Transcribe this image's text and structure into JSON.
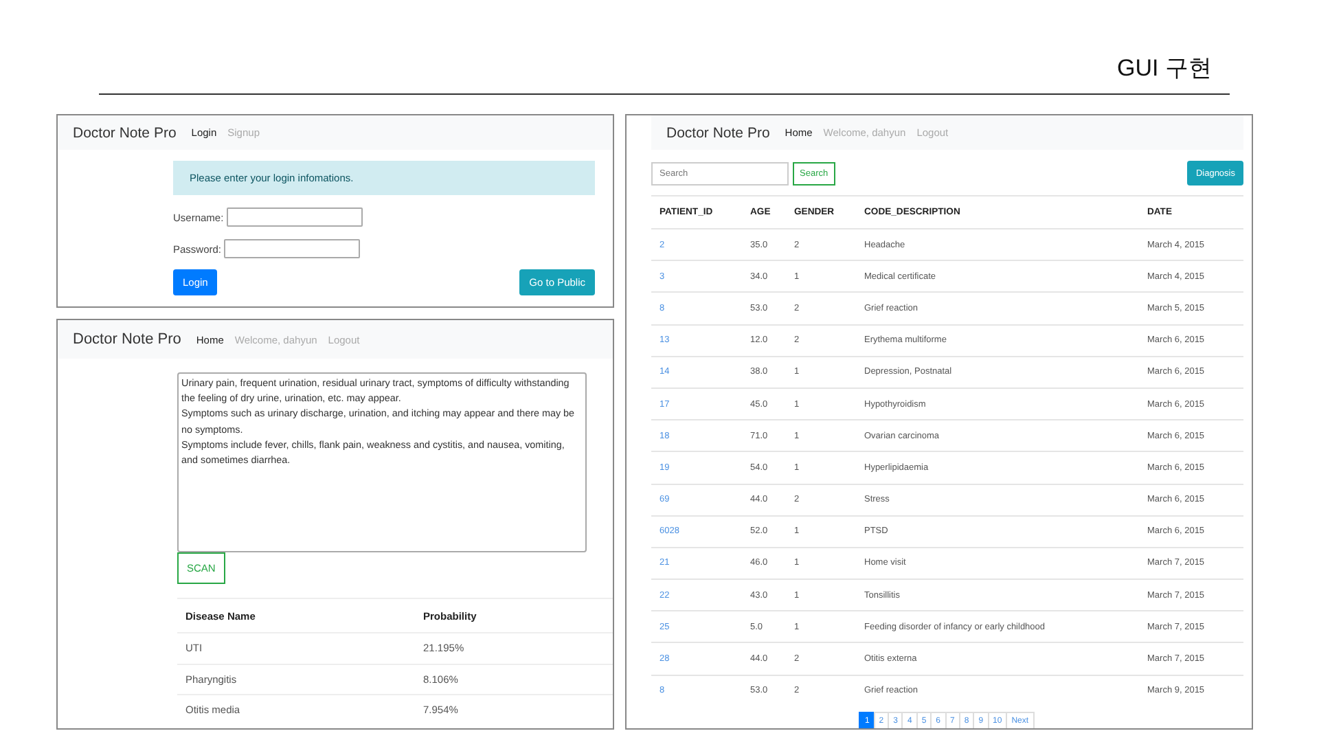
{
  "slide": {
    "title": "GUI 구현"
  },
  "login_screen": {
    "navbar": {
      "brand": "Doctor Note Pro",
      "links": [
        {
          "label": "Login",
          "selected": true
        },
        {
          "label": "Signup",
          "selected": false
        }
      ]
    },
    "alert": "Please enter your login infomations.",
    "fields": [
      {
        "label": "Username:"
      },
      {
        "label": "Password:"
      }
    ],
    "buttons": [
      {
        "label": "Login",
        "kind": "primary"
      },
      {
        "label": "Go to Public",
        "kind": "info"
      }
    ]
  },
  "scan_screen": {
    "navbar": {
      "brand": "Doctor Note Pro",
      "links": [
        {
          "label": "Home",
          "selected": true
        },
        {
          "label": "Welcome, dahyun",
          "selected": false
        },
        {
          "label": "Logout",
          "selected": false
        }
      ]
    },
    "symptoms_text": "Urinary pain, frequent urination, residual urinary tract, symptoms of difficulty withstanding the feeling of dry urine, urination, etc. may appear.\nSymptoms such as urinary discharge, urination, and itching may appear and there may be no symptoms.\nSymptoms include fever, chills, flank pain, weakness and cystitis, and nausea, vomiting, and sometimes diarrhea.",
    "scan_button": "SCAN",
    "results": {
      "columns": [
        "Disease Name",
        "Probability"
      ],
      "rows": [
        [
          "UTI",
          "21.195%"
        ],
        [
          "Pharyngitis",
          "8.106%"
        ],
        [
          "Otitis media",
          "7.954%"
        ]
      ]
    }
  },
  "patients_screen": {
    "navbar": {
      "brand": "Doctor Note Pro",
      "links": [
        {
          "label": "Home",
          "selected": true
        },
        {
          "label": "Welcome, dahyun",
          "selected": false
        },
        {
          "label": "Logout",
          "selected": false
        }
      ]
    },
    "search": {
      "placeholder": "Search"
    },
    "search_button": "Search",
    "diagnosis_button": "Diagnosis",
    "table": {
      "columns": [
        "PATIENT_ID",
        "AGE",
        "GENDER",
        "CODE_DESCRIPTION",
        "DATE"
      ],
      "rows": [
        [
          "2",
          "35.0",
          "2",
          "Headache",
          "March 4, 2015"
        ],
        [
          "3",
          "34.0",
          "1",
          "Medical certificate",
          "March 4, 2015"
        ],
        [
          "8",
          "53.0",
          "2",
          "Grief reaction",
          "March 5, 2015"
        ],
        [
          "13",
          "12.0",
          "2",
          "Erythema multiforme",
          "March 6, 2015"
        ],
        [
          "14",
          "38.0",
          "1",
          "Depression, Postnatal",
          "March 6, 2015"
        ],
        [
          "17",
          "45.0",
          "1",
          "Hypothyroidism",
          "March 6, 2015"
        ],
        [
          "18",
          "71.0",
          "1",
          "Ovarian carcinoma",
          "March 6, 2015"
        ],
        [
          "19",
          "54.0",
          "1",
          "Hyperlipidaemia",
          "March 6, 2015"
        ],
        [
          "69",
          "44.0",
          "2",
          "Stress",
          "March 6, 2015"
        ],
        [
          "6028",
          "52.0",
          "1",
          "PTSD",
          "March 6, 2015"
        ],
        [
          "21",
          "46.0",
          "1",
          "Home visit",
          "March 7, 2015"
        ],
        [
          "22",
          "43.0",
          "1",
          "Tonsillitis",
          "March 7, 2015"
        ],
        [
          "25",
          "5.0",
          "1",
          "Feeding disorder of infancy or early childhood",
          "March 7, 2015"
        ],
        [
          "28",
          "44.0",
          "2",
          "Otitis externa",
          "March 7, 2015"
        ],
        [
          "8",
          "53.0",
          "2",
          "Grief reaction",
          "March 9, 2015"
        ]
      ]
    },
    "pagination": {
      "pages": [
        {
          "label": "1",
          "selected": true
        },
        {
          "label": "2",
          "selected": false
        },
        {
          "label": "3",
          "selected": false
        },
        {
          "label": "4",
          "selected": false
        },
        {
          "label": "5",
          "selected": false
        },
        {
          "label": "6",
          "selected": false
        },
        {
          "label": "7",
          "selected": false
        },
        {
          "label": "8",
          "selected": false
        },
        {
          "label": "9",
          "selected": false
        },
        {
          "label": "10",
          "selected": false
        }
      ],
      "next": "Next"
    }
  }
}
